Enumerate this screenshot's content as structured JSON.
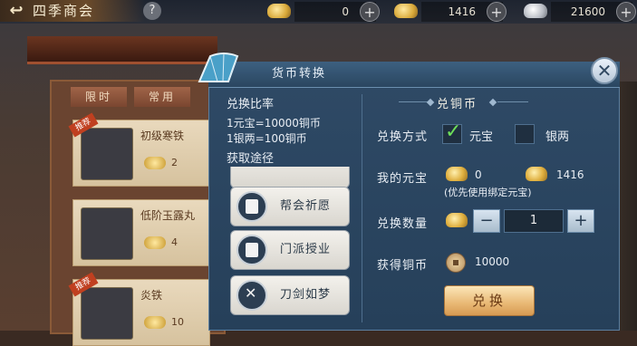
{
  "topbar": {
    "back_icon": "↩",
    "title": "四季商会",
    "help": "?",
    "currencies": [
      {
        "icon": "gold-ingot-icon",
        "value": "0"
      },
      {
        "icon": "gold-ingot-icon",
        "value": "1416"
      },
      {
        "icon": "silver-ingot-icon",
        "value": "21600"
      }
    ],
    "plus": "+"
  },
  "shop": {
    "tabs": [
      "限时",
      "常用"
    ],
    "items": [
      {
        "tag": "推荐",
        "name": "初级寒铁",
        "count": "2"
      },
      {
        "tag": "",
        "name": "低阶玉露丸",
        "count": "4"
      },
      {
        "tag": "推荐",
        "name": "炎铁",
        "count": "10"
      }
    ]
  },
  "dialog": {
    "title": "货币转换",
    "close": "✕",
    "rate_title": "兑换比率",
    "rate1": "1元宝=10000铜币",
    "rate2": "1银两=100铜币",
    "source_title": "获取途径",
    "sources": [
      {
        "label": "帮会祈愿",
        "icon": "banner-icon"
      },
      {
        "label": "门派授业",
        "icon": "banner-icon"
      },
      {
        "label": "刀剑如梦",
        "icon": "crossed-swords-icon"
      }
    ],
    "exchange_title": "兑铜币",
    "method_label": "兑换方式",
    "opt_yuanbao": "元宝",
    "opt_yinliang": "银两",
    "mine_label": "我的元宝",
    "mine_value": "0",
    "mine_bound_value": "1416",
    "mine_note": "(优先使用绑定元宝)",
    "qty_label": "兑换数量",
    "minus": "−",
    "qty_value": "1",
    "plus": "+",
    "get_label": "获得铜币",
    "get_value": "10000",
    "exchange_button": "兑换"
  }
}
